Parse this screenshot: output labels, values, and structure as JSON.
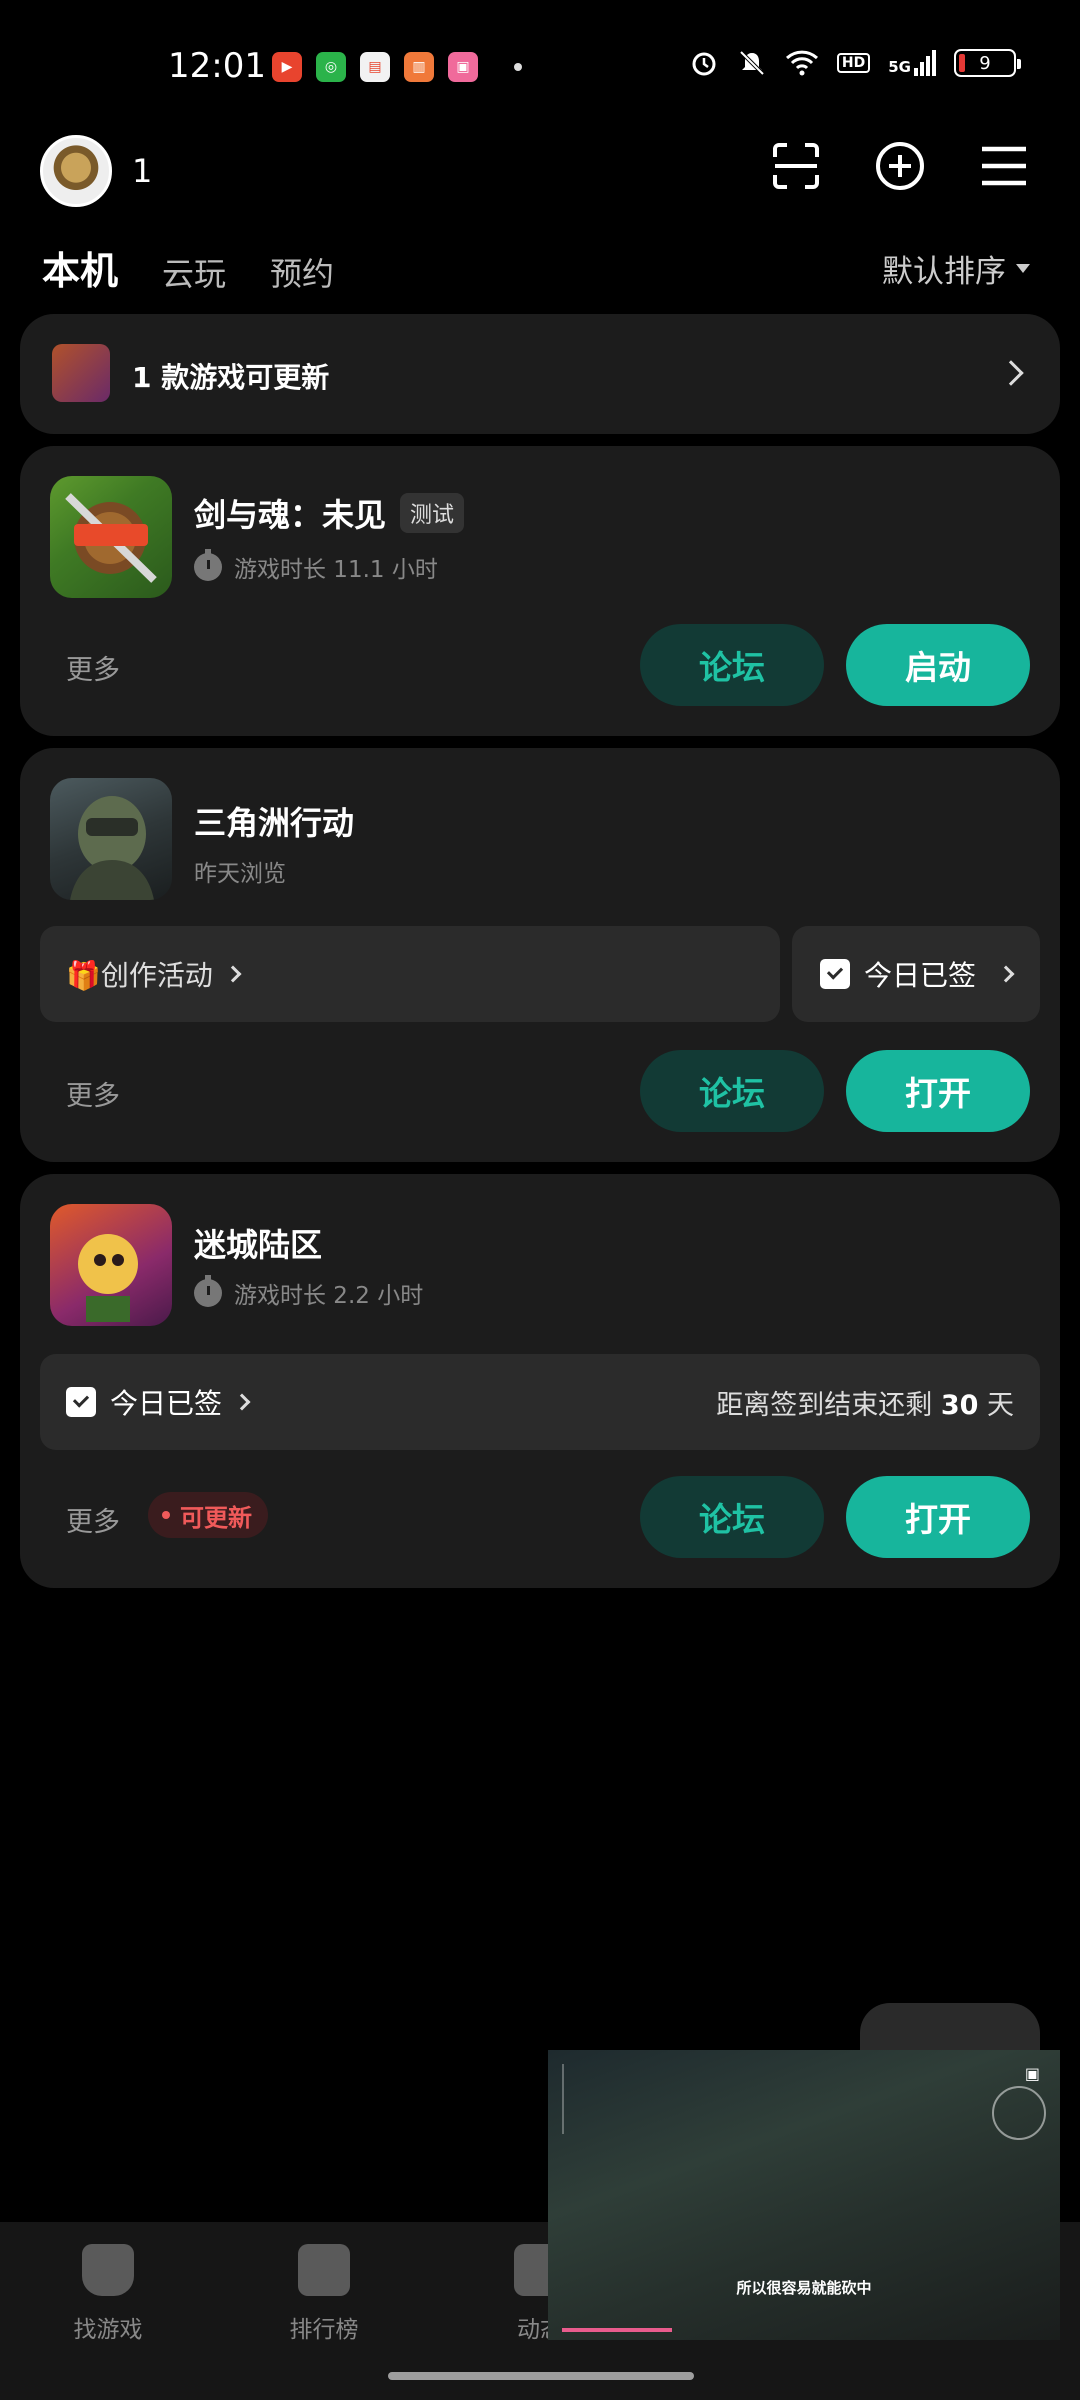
{
  "status_bar": {
    "time": "12:01",
    "hd": "HD",
    "signal": "5G",
    "battery": "9"
  },
  "header": {
    "user_name": "1"
  },
  "tabs": [
    {
      "label": "本机"
    },
    {
      "label": "云玩"
    },
    {
      "label": "预约"
    }
  ],
  "sort_label": "默认排序",
  "update_banner": {
    "label": "1 款游戏可更新"
  },
  "games": [
    {
      "name": "剑与魂：未见",
      "badge": "测试",
      "subtitle": "游戏时长 11.1 小时",
      "more": "更多",
      "forum": "论坛",
      "action": "启动"
    },
    {
      "name": "三角洲行动",
      "subtitle": "昨天浏览",
      "activity": "🎁创作活动",
      "signin": "今日已签",
      "more": "更多",
      "forum": "论坛",
      "action": "打开"
    },
    {
      "name": "迷城陆区",
      "subtitle": "游戏时长 2.2 小时",
      "signin": "今日已签",
      "countdown_prefix": "距离签到结束还剩 ",
      "countdown_days": "30",
      "countdown_suffix": " 天",
      "more": "更多",
      "update_badge": "可更新",
      "forum": "论坛",
      "action": "打开"
    }
  ],
  "bottom_nav": [
    {
      "label": "找游戏"
    },
    {
      "label": "排行榜"
    },
    {
      "label": "动态"
    }
  ],
  "pip": {
    "subtitle": "所以很容易就能砍中"
  },
  "colors": {
    "accent": "#17b59c",
    "card": "#1c1c1c",
    "update_red": "#f05a5a"
  }
}
